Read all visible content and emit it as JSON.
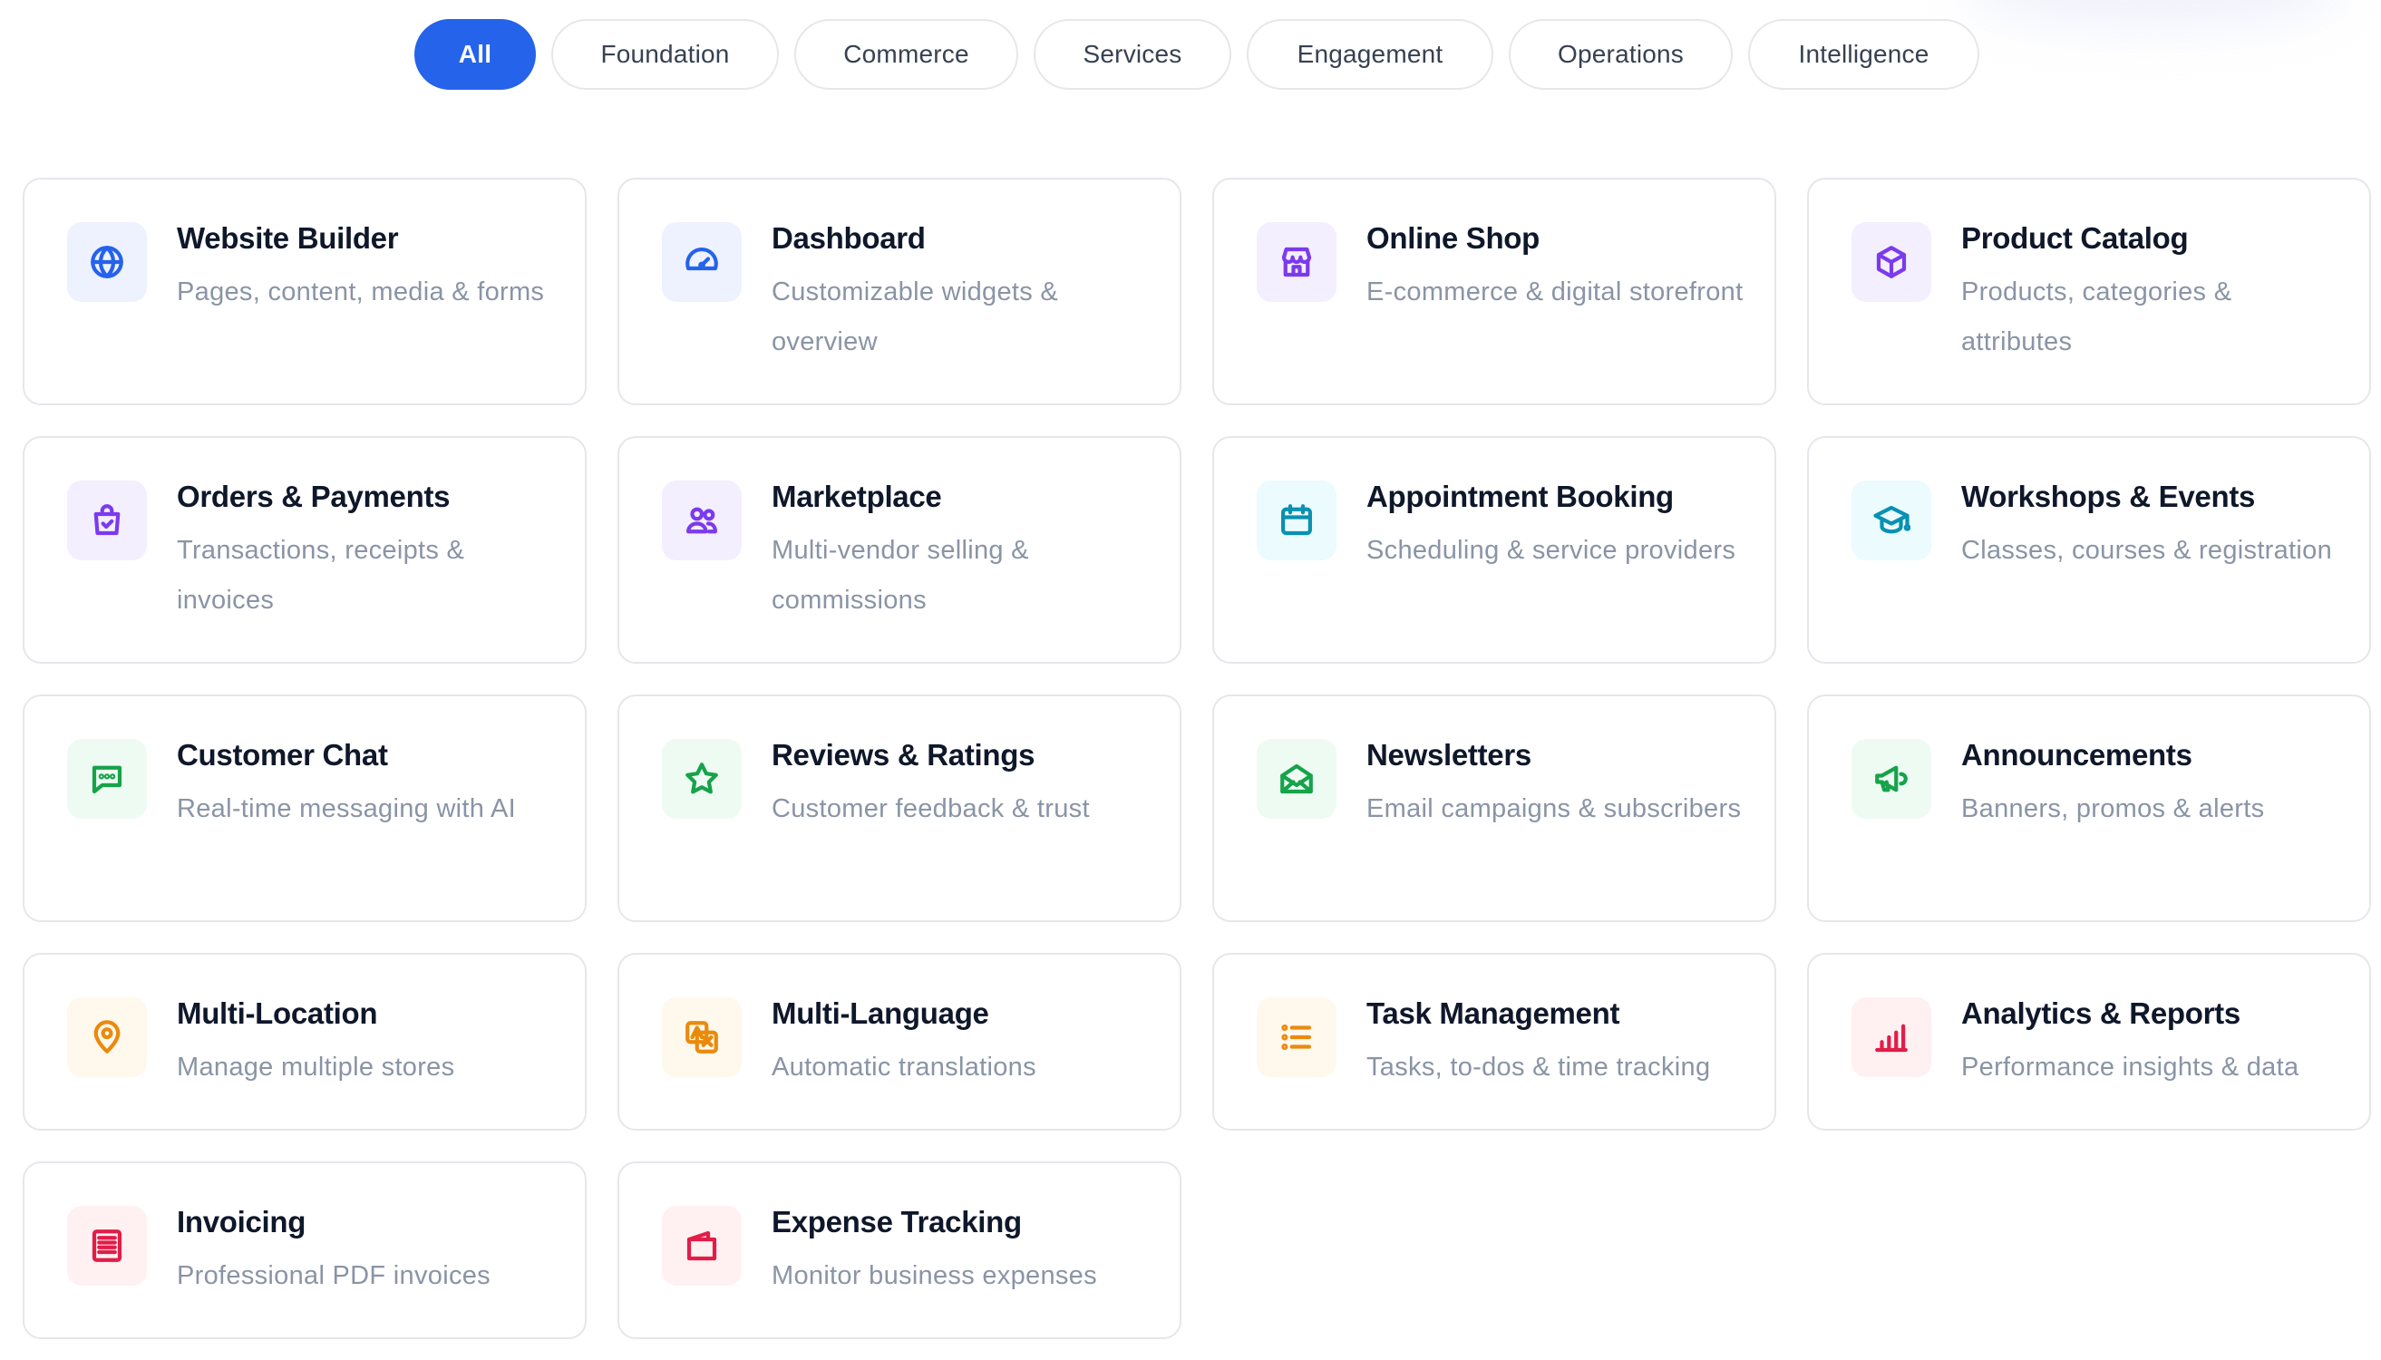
{
  "filters": {
    "items": [
      {
        "label": "All",
        "active": true
      },
      {
        "label": "Foundation",
        "active": false
      },
      {
        "label": "Commerce",
        "active": false
      },
      {
        "label": "Services",
        "active": false
      },
      {
        "label": "Engagement",
        "active": false
      },
      {
        "label": "Operations",
        "active": false
      },
      {
        "label": "Intelligence",
        "active": false
      }
    ]
  },
  "modules": [
    {
      "title": "Website Builder",
      "description": "Pages, content, media & forms",
      "icon": "globe-icon",
      "color": "#2563eb",
      "bg": "#eef2ff"
    },
    {
      "title": "Dashboard",
      "description": "Customizable widgets & overview",
      "icon": "gauge-icon",
      "color": "#2563eb",
      "bg": "#eef2ff"
    },
    {
      "title": "Online Shop",
      "description": "E-commerce & digital storefront",
      "icon": "store-icon",
      "color": "#7c3aed",
      "bg": "#f3efff"
    },
    {
      "title": "Product Catalog",
      "description": "Products, categories & attributes",
      "icon": "box-icon",
      "color": "#7c3aed",
      "bg": "#f3efff"
    },
    {
      "title": "Orders & Payments",
      "description": "Transactions, receipts & invoices",
      "icon": "shopping-bag-icon",
      "color": "#7c3aed",
      "bg": "#f3efff"
    },
    {
      "title": "Marketplace",
      "description": "Multi-vendor selling & commissions",
      "icon": "users-icon",
      "color": "#7c3aed",
      "bg": "#f3efff"
    },
    {
      "title": "Appointment Booking",
      "description": "Scheduling & service providers",
      "icon": "calendar-icon",
      "color": "#0891b2",
      "bg": "#ecfbfd"
    },
    {
      "title": "Workshops & Events",
      "description": "Classes, courses & registration",
      "icon": "graduation-cap-icon",
      "color": "#0891b2",
      "bg": "#ecfbfd"
    },
    {
      "title": "Customer Chat",
      "description": "Real-time messaging with AI",
      "icon": "chat-icon",
      "color": "#16a34a",
      "bg": "#eefbf3"
    },
    {
      "title": "Reviews & Ratings",
      "description": "Customer feedback & trust",
      "icon": "star-icon",
      "color": "#16a34a",
      "bg": "#eefbf3"
    },
    {
      "title": "Newsletters",
      "description": "Email campaigns & subscribers",
      "icon": "mail-icon",
      "color": "#16a34a",
      "bg": "#eefbf3"
    },
    {
      "title": "Announcements",
      "description": "Banners, promos & alerts",
      "icon": "megaphone-icon",
      "color": "#16a34a",
      "bg": "#eefbf3"
    },
    {
      "title": "Multi-Location",
      "description": "Manage multiple stores",
      "icon": "map-pin-icon",
      "color": "#ea8a0c",
      "bg": "#fff8ec"
    },
    {
      "title": "Multi-Language",
      "description": "Automatic translations",
      "icon": "translate-icon",
      "color": "#ea8a0c",
      "bg": "#fff8ec"
    },
    {
      "title": "Task Management",
      "description": "Tasks, to-dos & time tracking",
      "icon": "list-icon",
      "color": "#ea8a0c",
      "bg": "#fff8ec"
    },
    {
      "title": "Analytics & Reports",
      "description": "Performance insights & data",
      "icon": "bar-chart-icon",
      "color": "#e11d48",
      "bg": "#fff0f2"
    },
    {
      "title": "Invoicing",
      "description": "Professional PDF invoices",
      "icon": "receipt-icon",
      "color": "#e11d48",
      "bg": "#fff0f2"
    },
    {
      "title": "Expense Tracking",
      "description": "Monitor business expenses",
      "icon": "wallet-icon",
      "color": "#e11d48",
      "bg": "#fff0f2"
    }
  ]
}
